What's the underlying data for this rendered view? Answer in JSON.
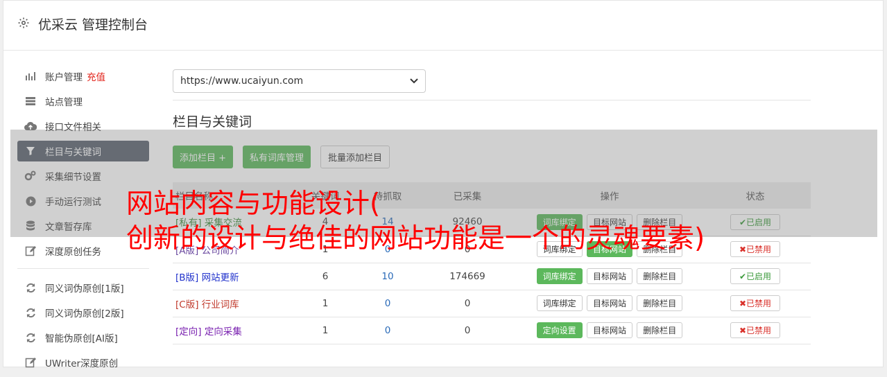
{
  "header": {
    "title": "优采云 管理控制台",
    "icon": "gear-icon"
  },
  "sidebar": {
    "items": [
      {
        "label": "账户管理",
        "extra": "充值",
        "icon": "bar-chart-icon"
      },
      {
        "label": "站点管理",
        "icon": "server-icon"
      },
      {
        "label": "接口文件相关",
        "icon": "cloud-upload-icon"
      },
      {
        "label": "栏目与关键词",
        "icon": "filter-icon",
        "active": true
      },
      {
        "label": "采集细节设置",
        "icon": "cogs-icon"
      },
      {
        "label": "手动运行测试",
        "icon": "play-circle-icon"
      },
      {
        "label": "文章暂存库",
        "icon": "database-icon"
      },
      {
        "label": "深度原创任务",
        "icon": "edit-icon"
      }
    ],
    "items2": [
      {
        "label": "同义词伪原创[1版]",
        "icon": "refresh-icon"
      },
      {
        "label": "同义词伪原创[2版]",
        "icon": "refresh-icon"
      },
      {
        "label": "智能伪原创[AI版]",
        "icon": "refresh-icon"
      },
      {
        "label": "UWriter深度原创",
        "icon": "edit-icon"
      }
    ]
  },
  "main": {
    "site_select": "https://www.ucaiyun.com",
    "section_title": "栏目与关键词",
    "buttons": {
      "add_column": "添加栏目 +",
      "private_lib": "私有词库管理",
      "batch_add": "批量添加栏目"
    },
    "table": {
      "headers": [
        "栏目名称",
        "关键词",
        "待抓取",
        "已采集",
        "操作",
        "状态"
      ],
      "rows": [
        {
          "tag": "[私有]",
          "name": "采集交流",
          "kw": "4",
          "pending": "14",
          "collected": "92460",
          "op1": "词库绑定",
          "op1_green": true,
          "op2": "目标网站",
          "op3": "删除栏目",
          "status": "✔已启用",
          "on": true
        },
        {
          "tag": "[A版]",
          "name": "公司简介",
          "kw": "1",
          "pending": "0",
          "collected": "0",
          "op1": "词库绑定",
          "op1_green": false,
          "op2": "目标网站",
          "op3": "删除栏目",
          "status": "✖已禁用",
          "on": false
        },
        {
          "tag": "[B版]",
          "name": "网站更新",
          "kw": "6",
          "pending": "10",
          "collected": "174669",
          "op1": "词库绑定",
          "op1_green": true,
          "op2": "目标网站",
          "op3": "删除栏目",
          "status": "✔已启用",
          "on": true
        },
        {
          "tag": "[C版]",
          "name": "行业词库",
          "kw": "1",
          "pending": "0",
          "collected": "0",
          "op1": "词库绑定",
          "op1_green": false,
          "op2": "目标网站",
          "op3": "删除栏目",
          "status": "✖已禁用",
          "on": false
        },
        {
          "tag": "[定向]",
          "name": "定向采集",
          "kw": "1",
          "pending": "0",
          "collected": "0",
          "op1": "定向设置",
          "op1_green": true,
          "op2": "目标网站",
          "op3": "删除栏目",
          "status": "✖已禁用",
          "on": false
        }
      ]
    }
  },
  "overlay": {
    "line1": "网站内容与功能设计(",
    "line2": "创新的设计与绝佳的网站功能是一个的灵魂要素)"
  },
  "colors": {
    "active_bg": "#5c6470",
    "green": "#5cb85c",
    "overlay_text": "#ff0000"
  }
}
